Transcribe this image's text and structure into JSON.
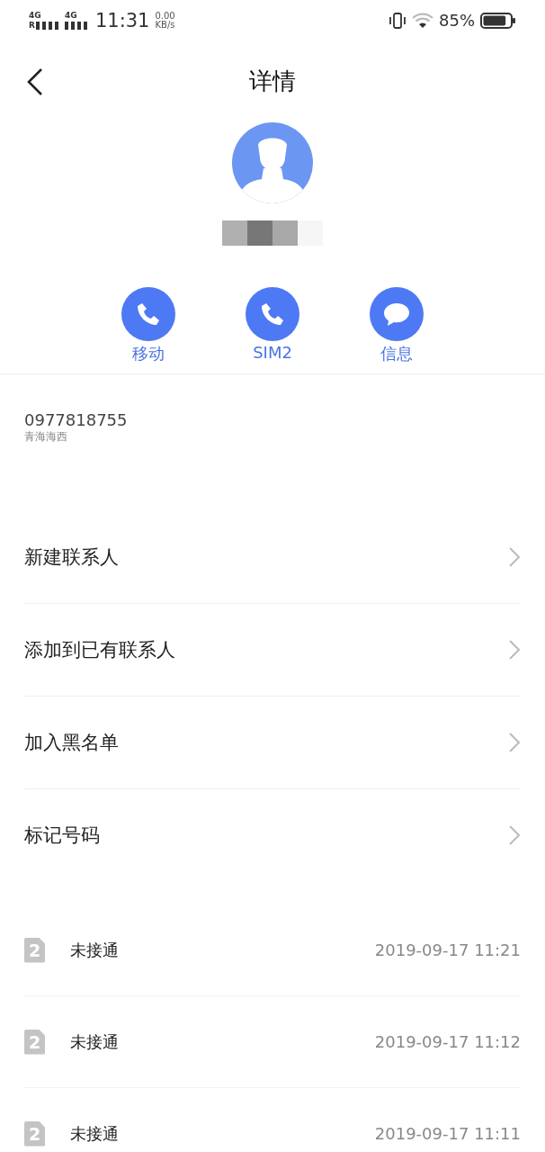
{
  "status_bar": {
    "sim1": {
      "network": "4G",
      "roaming": "R"
    },
    "sim2": {
      "network": "4G"
    },
    "time": "11:31",
    "speed_value": "0.00",
    "speed_unit": "KB/s",
    "battery": "85%"
  },
  "header": {
    "title": "详情"
  },
  "actions": [
    {
      "kind": "call",
      "label": "移动"
    },
    {
      "kind": "call",
      "label": "SIM2"
    },
    {
      "kind": "message",
      "label": "信息"
    }
  ],
  "number": {
    "value": "0977818755",
    "location": "青海海西"
  },
  "menu": [
    {
      "label": "新建联系人"
    },
    {
      "label": "添加到已有联系人"
    },
    {
      "label": "加入黑名单"
    },
    {
      "label": "标记号码"
    }
  ],
  "calls": [
    {
      "sim": "2",
      "status": "未接通",
      "time": "2019-09-17 11:21"
    },
    {
      "sim": "2",
      "status": "未接通",
      "time": "2019-09-17 11:12"
    },
    {
      "sim": "2",
      "status": "未接通",
      "time": "2019-09-17 11:11"
    }
  ]
}
